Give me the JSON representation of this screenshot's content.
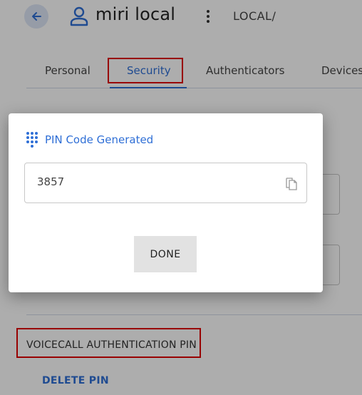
{
  "header": {
    "user_name": "miri local",
    "realm": "LOCAL/",
    "icons": {
      "back": "arrow-left-icon",
      "user": "user-icon",
      "menu": "more-vertical-icon"
    }
  },
  "tabs": [
    {
      "label": "Personal",
      "active": false
    },
    {
      "label": "Security",
      "active": true
    },
    {
      "label": "Authenticators",
      "active": false
    },
    {
      "label": "Devices",
      "active": false
    }
  ],
  "section": {
    "heading": "VOICECALL AUTHENTICATION PIN",
    "delete_label": "DELETE PIN"
  },
  "dialog": {
    "title": "PIN Code Generated",
    "pin_value": "3857",
    "done_label": "DONE",
    "icons": {
      "title": "dialpad-icon",
      "copy": "copy-icon"
    }
  },
  "colors": {
    "accent": "#2f6fd6",
    "highlight": "#e00000",
    "button_bg": "#e2e2e2"
  }
}
